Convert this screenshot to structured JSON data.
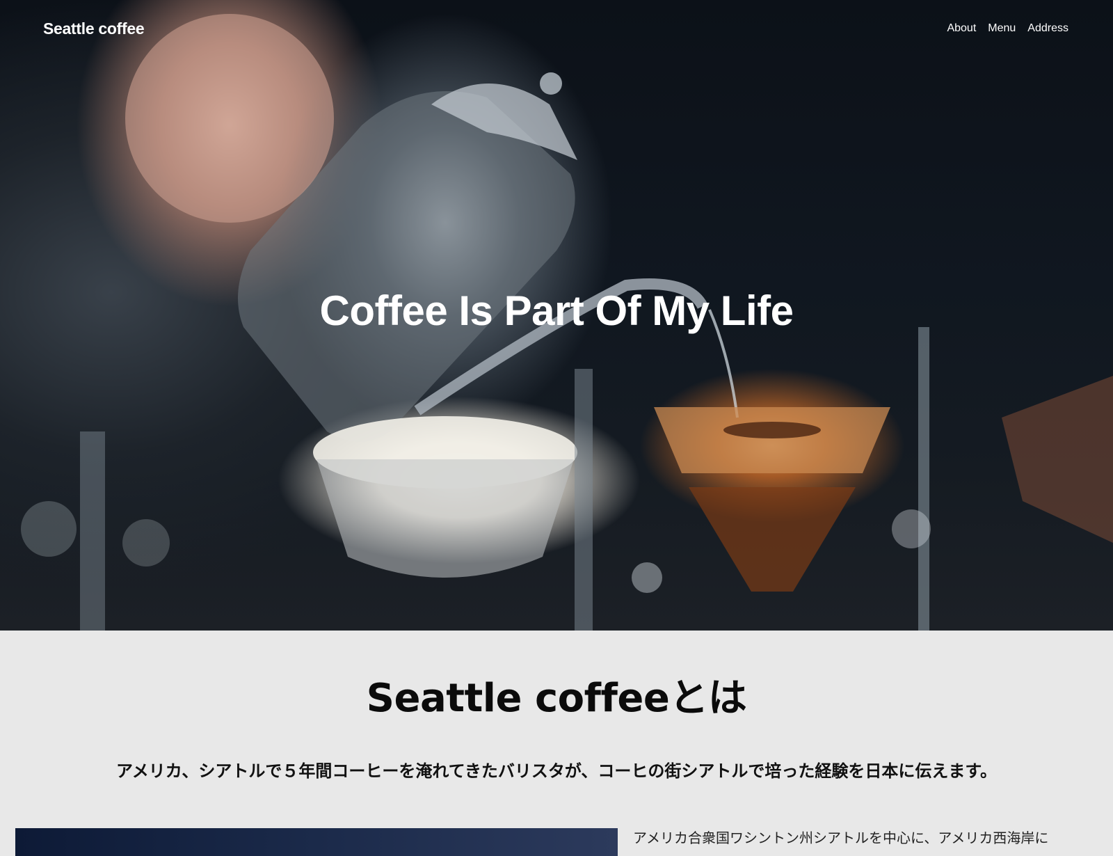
{
  "header": {
    "site_title": "Seattle coffee",
    "nav": [
      "About",
      "Menu",
      "Address"
    ]
  },
  "hero": {
    "heading": "Coffee Is Part Of My Life",
    "image": "barista-pouring-coffee-photo"
  },
  "about": {
    "title": "Seattle coffeeとは",
    "lead": "アメリカ、シアトルで５年間コーヒーを淹れてきたバリスタが、コーヒの街シアトルで培った経験を日本に伝えます。",
    "body_excerpt": "アメリカ合衆国ワシントン州シアトルを中心に、アメリカ西海岸に",
    "image": "city-photo"
  }
}
